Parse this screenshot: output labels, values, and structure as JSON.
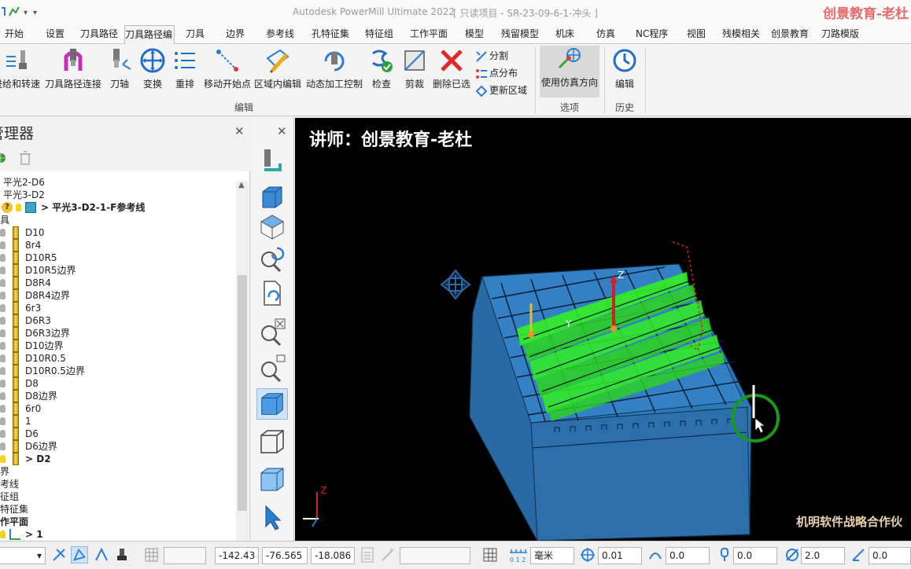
{
  "title_bar": {
    "app_title": "Autodesk PowerMill Ultimate 2022",
    "project": "[ 只读项目 - SR-23-09-6-1-冲头 ]",
    "watermark": "创景教育-老杜"
  },
  "tabs": [
    "开始",
    "设置",
    "刀具路径",
    "刀具路径编",
    "刀具",
    "边界",
    "参考线",
    "孔特征集",
    "特征组",
    "工作平面",
    "模型",
    "残留模型",
    "机床",
    "仿真",
    "NC程序",
    "视图",
    "残模相关",
    "创景教育",
    "刀路模版"
  ],
  "active_tab": "刀具路径编",
  "ribbon": {
    "buttons": [
      {
        "label": "进给和转速",
        "icon": "feed-speed-icon"
      },
      {
        "label": "刀具路径连接",
        "icon": "toolpath-connect-icon"
      },
      {
        "label": "刀轴",
        "icon": "tool-axis-icon"
      },
      {
        "label": "变换",
        "icon": "transform-icon"
      },
      {
        "label": "重排",
        "icon": "reorder-icon"
      },
      {
        "label": "移动开始点",
        "icon": "move-start-point-icon"
      },
      {
        "label": "区域内编辑",
        "icon": "region-edit-icon"
      },
      {
        "label": "动态加工控制",
        "icon": "dynamic-machining-icon"
      },
      {
        "label": "检查",
        "icon": "check-icon"
      },
      {
        "label": "剪裁",
        "icon": "trim-icon"
      },
      {
        "label": "删除已选",
        "icon": "delete-selected-icon"
      }
    ],
    "small_buttons": [
      "分割",
      "点分布",
      "更新区域"
    ],
    "option_button": "使用仿真方向",
    "history_button": "编辑",
    "groups": {
      "edit": "编辑",
      "options": "选项",
      "history": "历史"
    }
  },
  "explorer": {
    "title": "管理器",
    "tree": [
      {
        "text": "平光2-D6",
        "indent": 4,
        "kind": "plain"
      },
      {
        "text": "平光3-D2",
        "indent": 4,
        "kind": "plain"
      },
      {
        "text": "> 平光3-D2-1-F参考线",
        "indent": 52,
        "kind": "active"
      },
      {
        "text": "具",
        "indent": 0,
        "kind": "plain"
      },
      {
        "text": "D10",
        "indent": 32,
        "kind": "tool"
      },
      {
        "text": "8r4",
        "indent": 32,
        "kind": "tool"
      },
      {
        "text": "D10R5",
        "indent": 32,
        "kind": "tool"
      },
      {
        "text": "D10R5边界",
        "indent": 32,
        "kind": "tool"
      },
      {
        "text": "D8R4",
        "indent": 32,
        "kind": "tool"
      },
      {
        "text": "D8R4边界",
        "indent": 32,
        "kind": "tool"
      },
      {
        "text": "6r3",
        "indent": 32,
        "kind": "tool"
      },
      {
        "text": "D6R3",
        "indent": 32,
        "kind": "tool"
      },
      {
        "text": "D6R3边界",
        "indent": 32,
        "kind": "tool"
      },
      {
        "text": "D10边界",
        "indent": 32,
        "kind": "tool"
      },
      {
        "text": "D10R0.5",
        "indent": 32,
        "kind": "tool"
      },
      {
        "text": "D10R0.5边界",
        "indent": 32,
        "kind": "tool"
      },
      {
        "text": "D8",
        "indent": 32,
        "kind": "tool"
      },
      {
        "text": "D8边界",
        "indent": 32,
        "kind": "tool"
      },
      {
        "text": "6r0",
        "indent": 32,
        "kind": "tool"
      },
      {
        "text": "1",
        "indent": 32,
        "kind": "tool"
      },
      {
        "text": "D6",
        "indent": 32,
        "kind": "tool"
      },
      {
        "text": "D6边界",
        "indent": 32,
        "kind": "tool"
      },
      {
        "text": "> D2",
        "indent": 32,
        "kind": "tool-active"
      },
      {
        "text": "界",
        "indent": 0,
        "kind": "plain"
      },
      {
        "text": "考线",
        "indent": 0,
        "kind": "plain"
      },
      {
        "text": "征组",
        "indent": 0,
        "kind": "plain"
      },
      {
        "text": "特征集",
        "indent": 0,
        "kind": "plain"
      },
      {
        "text": "作平面",
        "indent": 0,
        "kind": "bold"
      },
      {
        "text": "> 1",
        "indent": 32,
        "kind": "workplane"
      }
    ]
  },
  "viewport": {
    "teacher_caption": "讲师：创景教育-老杜",
    "partner_caption": "机明软件战略合作伙",
    "axis_z": "Z",
    "axis_y": "Y"
  },
  "status_bar": {
    "x": "-142.43",
    "y": "-76.565",
    "z": "-18.086",
    "unit": "毫米",
    "tolerance": "0.01",
    "thickness": "0.0",
    "axial_thickness": "0.0",
    "diameter": "2.0",
    "step": "0.0"
  },
  "colors": {
    "model_blue": "#2f78b8",
    "toolpath_green": "#33ee22",
    "viewport_bg": "#000000",
    "watermark_red": "#e86a6a"
  }
}
